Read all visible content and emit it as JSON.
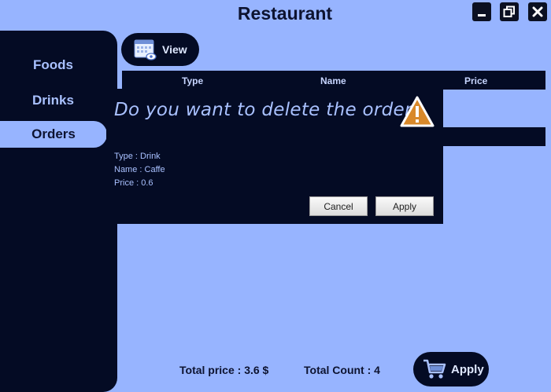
{
  "window": {
    "title": "Restaurant",
    "controls": {
      "minimize": "minimize-icon",
      "maximize": "maximize-icon",
      "close": "close-icon"
    }
  },
  "sidebar": {
    "items": [
      {
        "label": "Foods",
        "selected": false
      },
      {
        "label": "Drinks",
        "selected": false
      },
      {
        "label": "Orders",
        "selected": true
      }
    ]
  },
  "toolbar": {
    "view_label": "View",
    "view_icon": "calendar-view-icon"
  },
  "table": {
    "columns": [
      "Type",
      "Name",
      "Price"
    ]
  },
  "dialog": {
    "question": "Do you want to delete the order?",
    "icon": "warning-icon",
    "details": [
      "Type : Drink",
      "Name : Caffe",
      "Price : 0.6"
    ],
    "cancel_label": "Cancel",
    "apply_label": "Apply"
  },
  "footer": {
    "total_price": "Total price : 3.6 $",
    "total_count": "Total Count : 4",
    "apply_label": "Apply",
    "apply_icon": "shopping-cart-icon"
  },
  "colors": {
    "background": "#97b4ff",
    "panel": "#040b24",
    "text_light": "#a9c1ff",
    "warning": "#d9892a"
  }
}
